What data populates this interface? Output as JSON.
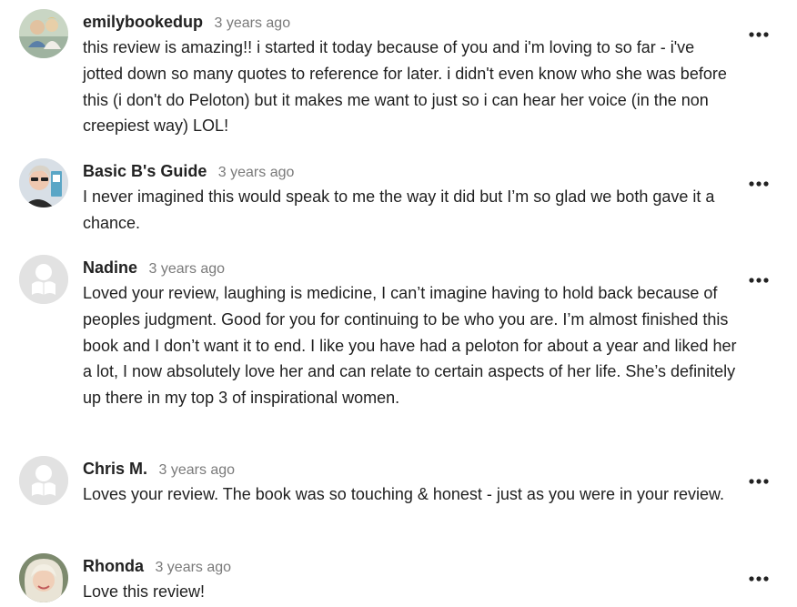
{
  "comments": [
    {
      "author": "emilybookedup",
      "time": "3 years ago",
      "text": "this review is amazing!! i started it today because of you and i'm loving to so far - i've jotted down so many quotes to reference for later. i didn't even know who she was before this (i don't do Peloton) but it makes me want to just so i can hear her voice (in the non creepiest way) LOL!",
      "avatar": "photo-avatar"
    },
    {
      "author": "Basic B's Guide",
      "time": "3 years ago",
      "text": "I never imagined this would speak to me the way it did but I’m so glad we both gave it a chance.",
      "avatar": "photo-avatar"
    },
    {
      "author": "Nadine",
      "time": "3 years ago",
      "text": "Loved your review, laughing is medicine, I can’t imagine having to hold back because of peoples judgment. Good for you for continuing to be who you are. I’m almost finished this book and I don’t want it to end. I like you have had a peloton for about a year and liked her a lot, I now absolutely love her and can relate to certain aspects of her life. She’s definitely up there in my top 3 of inspirational women.",
      "avatar": "default-reader-avatar"
    },
    {
      "author": "Chris M.",
      "time": "3 years ago",
      "text": "Loves your review. The book was so touching & honest - just as you were in your review.",
      "avatar": "default-reader-avatar"
    },
    {
      "author": "Rhonda",
      "time": "3 years ago",
      "text": "Love this review!",
      "avatar": "photo-avatar"
    }
  ],
  "icons": {
    "more": "more-options-icon"
  }
}
